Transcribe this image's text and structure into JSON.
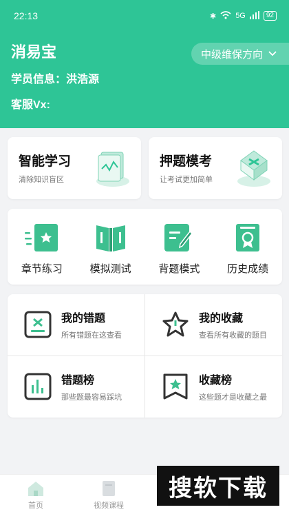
{
  "status": {
    "time": "22:13",
    "battery": "92",
    "network": "5G"
  },
  "header": {
    "app_name": "消易宝",
    "student_label": "学员信息：洪浩源",
    "service_label": "客服Vx:",
    "direction": "中级维保方向"
  },
  "feature_cards": [
    {
      "title": "智能学习",
      "subtitle": "清除知识盲区"
    },
    {
      "title": "押题模考",
      "subtitle": "让考试更加简单"
    }
  ],
  "practice_items": [
    {
      "label": "章节练习",
      "icon": "chapter-practice-icon"
    },
    {
      "label": "模拟测试",
      "icon": "mock-test-icon"
    },
    {
      "label": "背题模式",
      "icon": "memorize-icon"
    },
    {
      "label": "历史成绩",
      "icon": "history-score-icon"
    }
  ],
  "collections": [
    {
      "title": "我的错题",
      "subtitle": "所有错题在这查看",
      "icon": "wrong-questions-icon"
    },
    {
      "title": "我的收藏",
      "subtitle": "查看所有收藏的题目",
      "icon": "favorites-star-icon"
    },
    {
      "title": "错题榜",
      "subtitle": "那些题最容易踩坑",
      "icon": "wrong-ranking-icon"
    },
    {
      "title": "收藏榜",
      "subtitle": "这些题才是收藏之最",
      "icon": "favorite-ranking-icon"
    }
  ],
  "tabs": [
    {
      "label": "首页",
      "icon": "home-icon"
    },
    {
      "label": "视频课程",
      "icon": "video-course-icon"
    }
  ],
  "watermark": "搜软下载",
  "colors": {
    "accent": "#2ec596",
    "icon_green": "#3dbf8f",
    "icon_dark": "#333333"
  }
}
